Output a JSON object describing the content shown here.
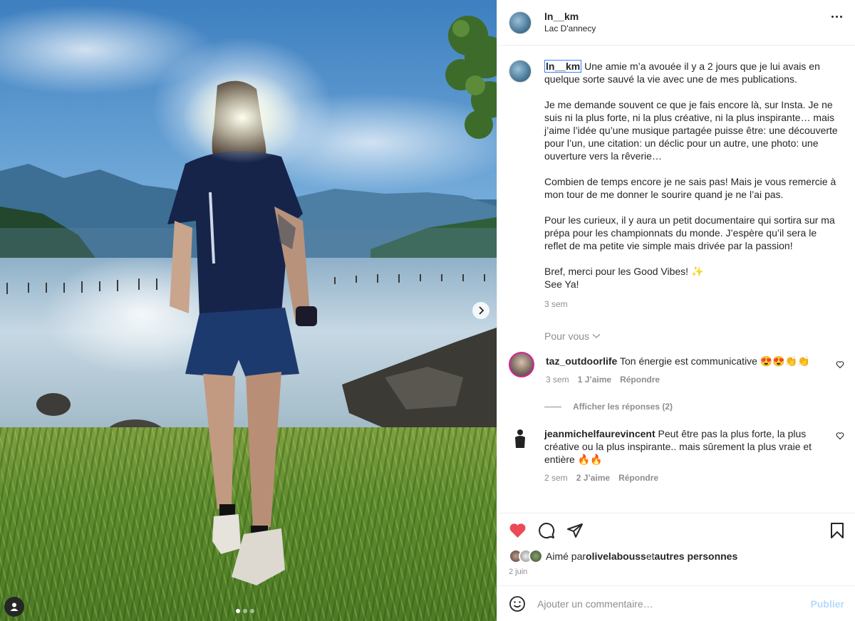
{
  "post": {
    "username": "ln__km",
    "location": "Lac D'annecy",
    "carousel": {
      "slides": 3,
      "active": 1
    }
  },
  "caption": {
    "username": "ln__km",
    "text": " Une amie m’a avouée il y a 2 jours que je lui avais en quelque sorte sauvé la vie avec une de mes publications.\n\nJe me demande souvent ce que je fais encore là, sur Insta. Je ne suis ni la plus forte, ni la plus créative, ni la plus inspirante… mais j’aime l’idée qu’une musique partagée puisse être: une découverte pour l’un, une citation: un déclic pour un autre, une photo: une ouverture vers la rêverie…\n\nCombien de temps encore je ne sais pas! Mais je vous remercie à mon tour de me donner le sourire quand je ne l’ai pas.\n\nPour les curieux, il y aura un petit documentaire qui sortira sur ma prépa pour les championnats du monde. J’espère qu’il sera le reflet de ma petite vie simple mais drivée par la passion!\n\nBref, merci pour les Good Vibes! ✨\nSee Ya!",
    "time": "3 sem"
  },
  "for_you_label": "Pour vous",
  "comments": [
    {
      "username": "taz_outdoorlife",
      "text": " Ton énergie est communicative 😍😍👏👏",
      "time": "3 sem",
      "likes": "1 J’aime",
      "reply_label": "Répondre",
      "view_replies": "Afficher les réponses (2)"
    },
    {
      "username": "jeanmichelfaurevincent",
      "text": " Peut être pas la plus forte, la plus créative ou la plus inspirante.. mais sûrement la plus vraie et entière 🔥🔥",
      "time": "2 sem",
      "likes": "2 J’aime",
      "reply_label": "Répondre"
    }
  ],
  "likes": {
    "prefix": "Aimé par ",
    "user": "olivelabouss",
    "suffix": " et ",
    "others": "autres personnes"
  },
  "date": "2 juin",
  "comment_box": {
    "placeholder": "Ajouter un commentaire…",
    "publish_label": "Publier"
  },
  "colors": {
    "like_red": "#ed4956",
    "publish_disabled": "#b3dbff",
    "muted": "#8e8e8e"
  },
  "icons": [
    "more-icon",
    "next-arrow-icon",
    "user-tag-icon",
    "heart-icon",
    "comment-icon",
    "share-icon",
    "save-icon",
    "emoji-icon",
    "chevron-down-icon"
  ]
}
